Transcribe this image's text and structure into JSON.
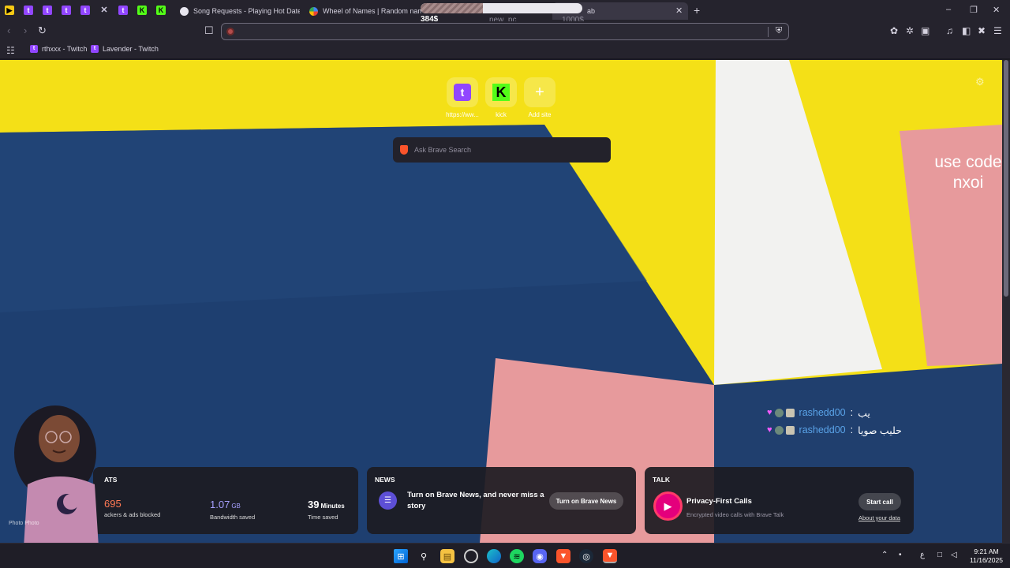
{
  "browser": {
    "tabs": [
      {
        "title": "Song Requests - Playing Hot Date! &",
        "favicon": "music-circle-icon"
      },
      {
        "title": "Wheel of Names | Random name pi",
        "favicon": "wheel-icon"
      },
      {
        "title": "ab",
        "favicon": "brave-icon"
      }
    ],
    "pinned_tabs": [
      {
        "icon": "youtube-music-icon",
        "glyph": "▶"
      },
      {
        "icon": "twitch-icon",
        "glyph": "t"
      },
      {
        "icon": "twitch-icon",
        "glyph": "t"
      },
      {
        "icon": "twitch-icon",
        "glyph": "t"
      },
      {
        "icon": "twitch-icon",
        "glyph": "t"
      },
      {
        "icon": "muted-icon",
        "glyph": "✕"
      },
      {
        "icon": "twitch-icon",
        "glyph": "t"
      },
      {
        "icon": "kick-icon",
        "glyph": "K"
      },
      {
        "icon": "kick-icon",
        "glyph": "K"
      }
    ],
    "new_tab_glyph": "+",
    "window_controls": {
      "minimize": "–",
      "restore": "❐",
      "close": "✕"
    },
    "close_tab_glyph": "✕",
    "address_value": "",
    "bookmarks": [
      {
        "label": "rthxxx - Twitch",
        "icon": "twitch-icon"
      },
      {
        "label": "Lavender - Twitch",
        "icon": "twitch-icon"
      }
    ]
  },
  "goal_widget": {
    "current": "384$",
    "label": "new_pc",
    "target": "1000$",
    "progress": 0.384
  },
  "new_tab_page": {
    "top_sites": [
      {
        "label": "https://ww...",
        "icon": "twitch-icon"
      },
      {
        "label": "kick",
        "icon": "kick-icon"
      },
      {
        "label": "Add site",
        "icon": "plus-icon"
      }
    ],
    "search_placeholder": "Ask Brave Search",
    "stream_overlay_text": "use code nxoi",
    "chat": [
      {
        "user": "rashedd00",
        "separator": ":",
        "message": "يب"
      },
      {
        "user": "rashedd00",
        "separator": ":",
        "message": "حليب صويا"
      }
    ],
    "stats": {
      "title": "ATS",
      "trackers_value": "695",
      "trackers_label": "ackers & ads blocked",
      "bandwidth_value": "1.07",
      "bandwidth_unit": "GB",
      "bandwidth_label": "Bandwidth saved",
      "time_value": "39",
      "time_unit": "Minutes",
      "time_label": "Time saved"
    },
    "news": {
      "title": "NEWS",
      "text": "Turn on Brave News, and never miss a story",
      "button": "Turn on Brave News"
    },
    "talk": {
      "title": "TALK",
      "heading": "Privacy-First Calls",
      "subtitle": "Encrypted video calls with Brave Talk",
      "button": "Start call",
      "link": "About your data"
    },
    "photo_credit": "Photo  Photo"
  },
  "taskbar": {
    "apps": [
      "windows-start-icon",
      "search-icon",
      "file-explorer-icon",
      "chrome-icon",
      "edge-icon",
      "spotify-icon",
      "discord-icon",
      "brave-icon",
      "steam-icon",
      "brave-nightly-icon"
    ],
    "tray_lang": "ع",
    "time": "9:21 AM",
    "date": "11/16/2025"
  },
  "colors": {
    "wall_yellow": "#f4e017",
    "wall_blue": "#1e3f70",
    "wall_white": "#f2f2f0",
    "wall_pink": "#e79a9c",
    "accent_purple": "#a6a0ff",
    "accent_orange": "#ff7954"
  }
}
